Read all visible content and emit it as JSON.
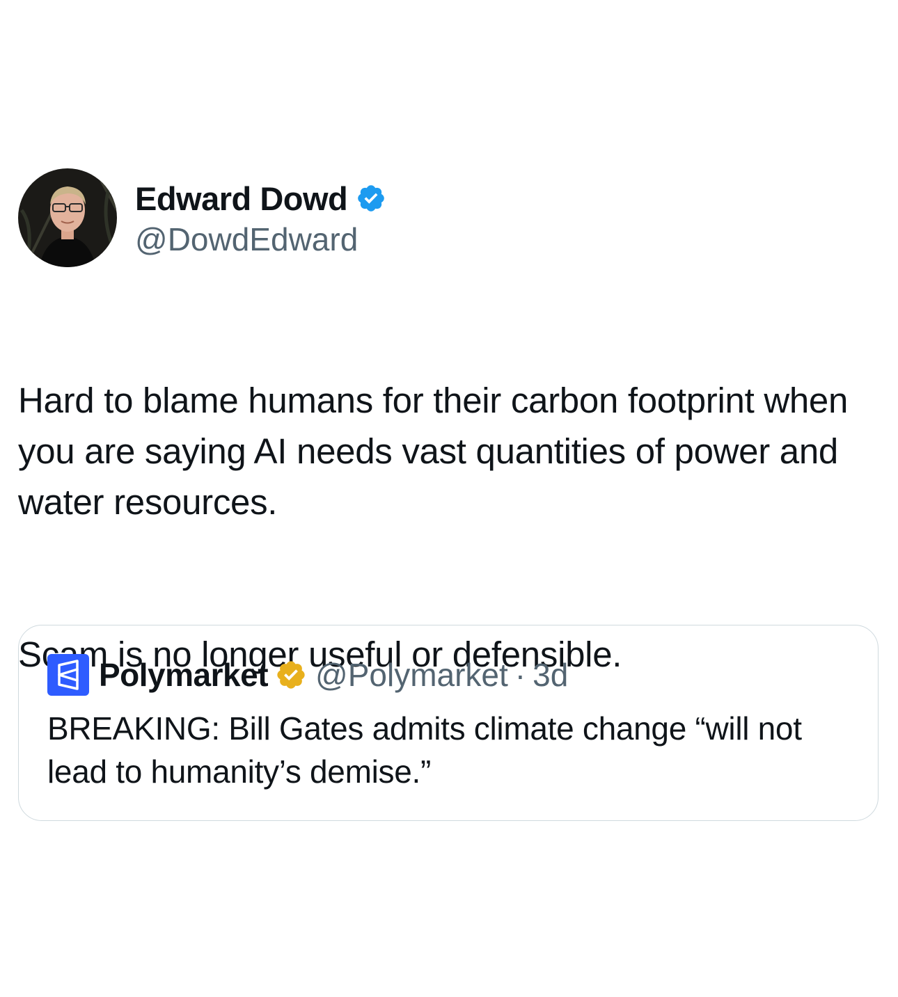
{
  "author": {
    "name": "Edward Dowd",
    "handle": "@DowdEdward",
    "verified_badge": "blue-check-icon",
    "badge_color": "#1d9bf0"
  },
  "tweet": {
    "paragraph_1": "Hard to blame humans for their carbon footprint when you are saying AI needs vast quantities of power and water resources.",
    "paragraph_2": "Scam is no longer useful or defensible."
  },
  "quoted_tweet": {
    "name": "Polymarket",
    "handle": "@Polymarket",
    "separator": "·",
    "time": "3d",
    "verified_badge": "gold-check-icon",
    "badge_color": "#e8b01d",
    "logo_color": "#2e5cff",
    "text": "BREAKING: Bill Gates admits climate change “will not lead to humanity’s demise.”"
  }
}
